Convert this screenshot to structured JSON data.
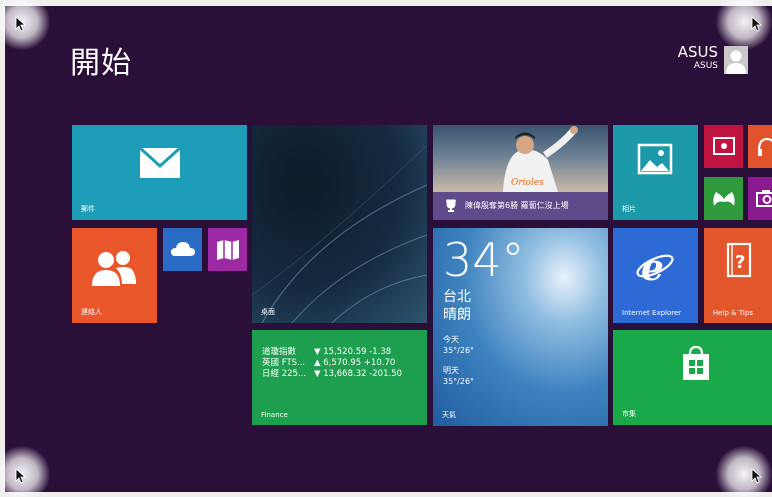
{
  "start": {
    "title": "開始"
  },
  "user": {
    "name": "ASUS",
    "subtitle": "ASUS"
  },
  "tiles": {
    "mail": {
      "label": "郵件"
    },
    "people": {
      "label": "連絡人"
    },
    "desktop": {
      "label": "桌面"
    },
    "sports": {
      "headline": "陳偉殷奪第6勝 蘿蔔仁沒上場"
    },
    "photos": {
      "label": "相片"
    },
    "weather": {
      "temp": "34°",
      "city": "台北",
      "condition": "晴朗",
      "today_label": "今天",
      "today_range": "35°/26°",
      "tomorrow_label": "明天",
      "tomorrow_range": "35°/26°",
      "label": "天氣"
    },
    "ie": {
      "label": "Internet Explorer"
    },
    "help": {
      "label": "Help & Tips"
    },
    "finance": {
      "label": "Finance",
      "rows": [
        {
          "name": "道瓊指數",
          "arrow": "▼",
          "value": "15,520.59 -1.38"
        },
        {
          "name": "英國 FTS...",
          "arrow": "▲",
          "value": "6,570.95 +10.70"
        },
        {
          "name": "日經 225...",
          "arrow": "▼",
          "value": "13,668.32 -201.50"
        }
      ]
    },
    "store": {
      "label": "市集"
    }
  },
  "colors": {
    "background": "#2a0f38",
    "mail": "#1d9db8",
    "people": "#e8562a",
    "onedrive": "#2a6bc5",
    "maps": "#9c2aa4",
    "photos": "#1c9aa9",
    "video": "#c1133f",
    "music": "#e0532b",
    "games": "#2e9a3c",
    "camera": "#8a1a8f",
    "ie": "#2d6ad5",
    "help": "#e4572c",
    "finance": "#1e9e4f",
    "store": "#19a84a"
  }
}
